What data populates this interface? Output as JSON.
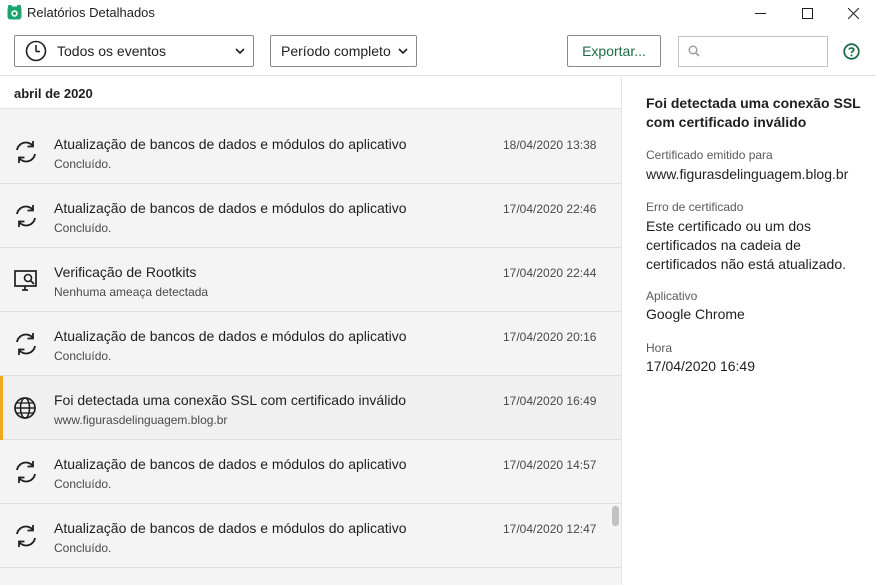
{
  "window": {
    "title": "Relatórios Detalhados"
  },
  "toolbar": {
    "events_filter": "Todos os eventos",
    "period_filter": "Período completo",
    "export_label": "Exportar...",
    "search_value": ""
  },
  "list": {
    "month": "abril de 2020",
    "rows": [
      {
        "icon": "sync-icon",
        "title": "Atualização de bancos de dados e módulos do aplicativo",
        "subtitle": "Concluído.",
        "datetime": "18/04/2020 13:38"
      },
      {
        "icon": "sync-icon",
        "title": "Atualização de bancos de dados e módulos do aplicativo",
        "subtitle": "Concluído.",
        "datetime": "17/04/2020 22:46"
      },
      {
        "icon": "rootkit-scan-icon",
        "title": "Verificação de Rootkits",
        "subtitle": "Nenhuma ameaça detectada",
        "datetime": "17/04/2020 22:44"
      },
      {
        "icon": "sync-icon",
        "title": "Atualização de bancos de dados e módulos do aplicativo",
        "subtitle": "Concluído.",
        "datetime": "17/04/2020 20:16"
      },
      {
        "icon": "globe-icon",
        "title": "Foi detectada uma conexão SSL com certificado inválido",
        "subtitle": "www.figurasdelinguagem.blog.br",
        "datetime": "17/04/2020 16:49",
        "selected": true
      },
      {
        "icon": "sync-icon",
        "title": "Atualização de bancos de dados e módulos do aplicativo",
        "subtitle": "Concluído.",
        "datetime": "17/04/2020 14:57"
      },
      {
        "icon": "sync-icon",
        "title": "Atualização de bancos de dados e módulos do aplicativo",
        "subtitle": "Concluído.",
        "datetime": "17/04/2020 12:47"
      }
    ]
  },
  "detail": {
    "title": "Foi detectada uma conexão SSL com certificado inválido",
    "cert_issued_label": "Certificado emitido para",
    "cert_issued_value": "www.figurasdelinguagem.blog.br",
    "cert_error_label": "Erro de certificado",
    "cert_error_value": "Este certificado ou um dos certificados na cadeia de certificados não está atualizado.",
    "app_label": "Aplicativo",
    "app_value": "Google Chrome",
    "time_label": "Hora",
    "time_value": "17/04/2020 16:49"
  },
  "colors": {
    "accent_green": "#1d6b48",
    "selection_accent": "#f5a623"
  }
}
